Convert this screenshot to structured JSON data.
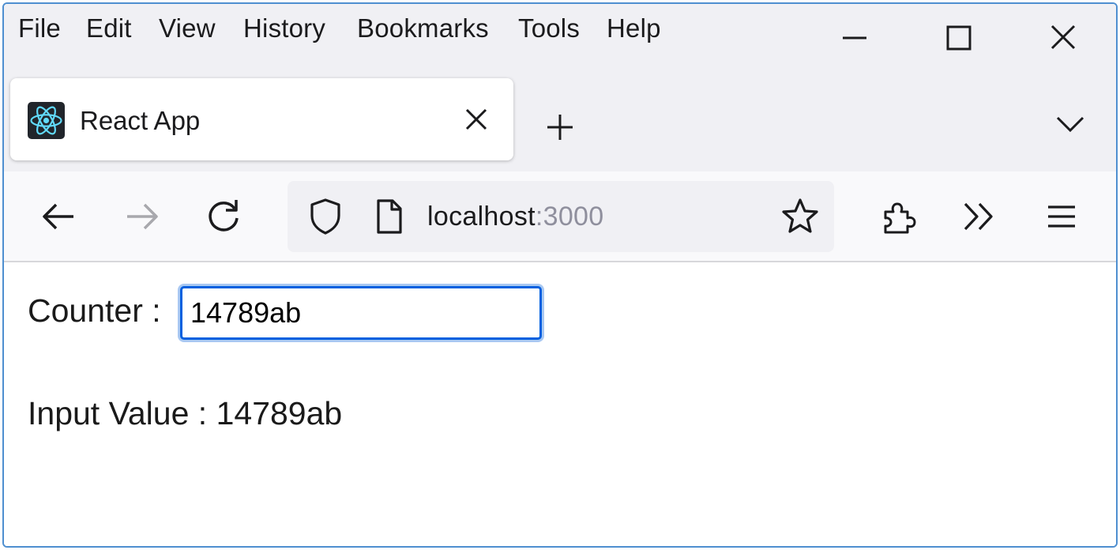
{
  "menu": {
    "items": [
      {
        "label": "File"
      },
      {
        "label": "Edit"
      },
      {
        "label": "View"
      },
      {
        "label": "History"
      },
      {
        "label": "Bookmarks"
      },
      {
        "label": "Tools"
      },
      {
        "label": "Help"
      }
    ]
  },
  "window_controls": {
    "minimize_icon": "minimize-icon",
    "maximize_icon": "maximize-icon",
    "close_icon": "close-icon"
  },
  "tab": {
    "title": "React App",
    "favicon": "react-logo-icon",
    "close_icon": "close-icon"
  },
  "toolbar": {
    "back_icon": "back-arrow-icon",
    "forward_icon": "forward-arrow-icon",
    "reload_icon": "reload-icon",
    "shield_icon": "shield-icon",
    "page_icon": "page-icon",
    "bookmark_icon": "star-icon",
    "extensions_icon": "puzzle-icon",
    "overflow_icon": "chevron-double-right-icon",
    "menu_icon": "hamburger-icon"
  },
  "address_bar": {
    "host": "localhost",
    "port": ":3000"
  },
  "page": {
    "counter_label": "Counter :",
    "counter_value": "14789ab",
    "output_label": "Input Value :",
    "output_value": "14789ab"
  },
  "colors": {
    "focus_border": "#0060df",
    "react_logo": "#61dafb",
    "window_border": "#4f8fd0"
  }
}
